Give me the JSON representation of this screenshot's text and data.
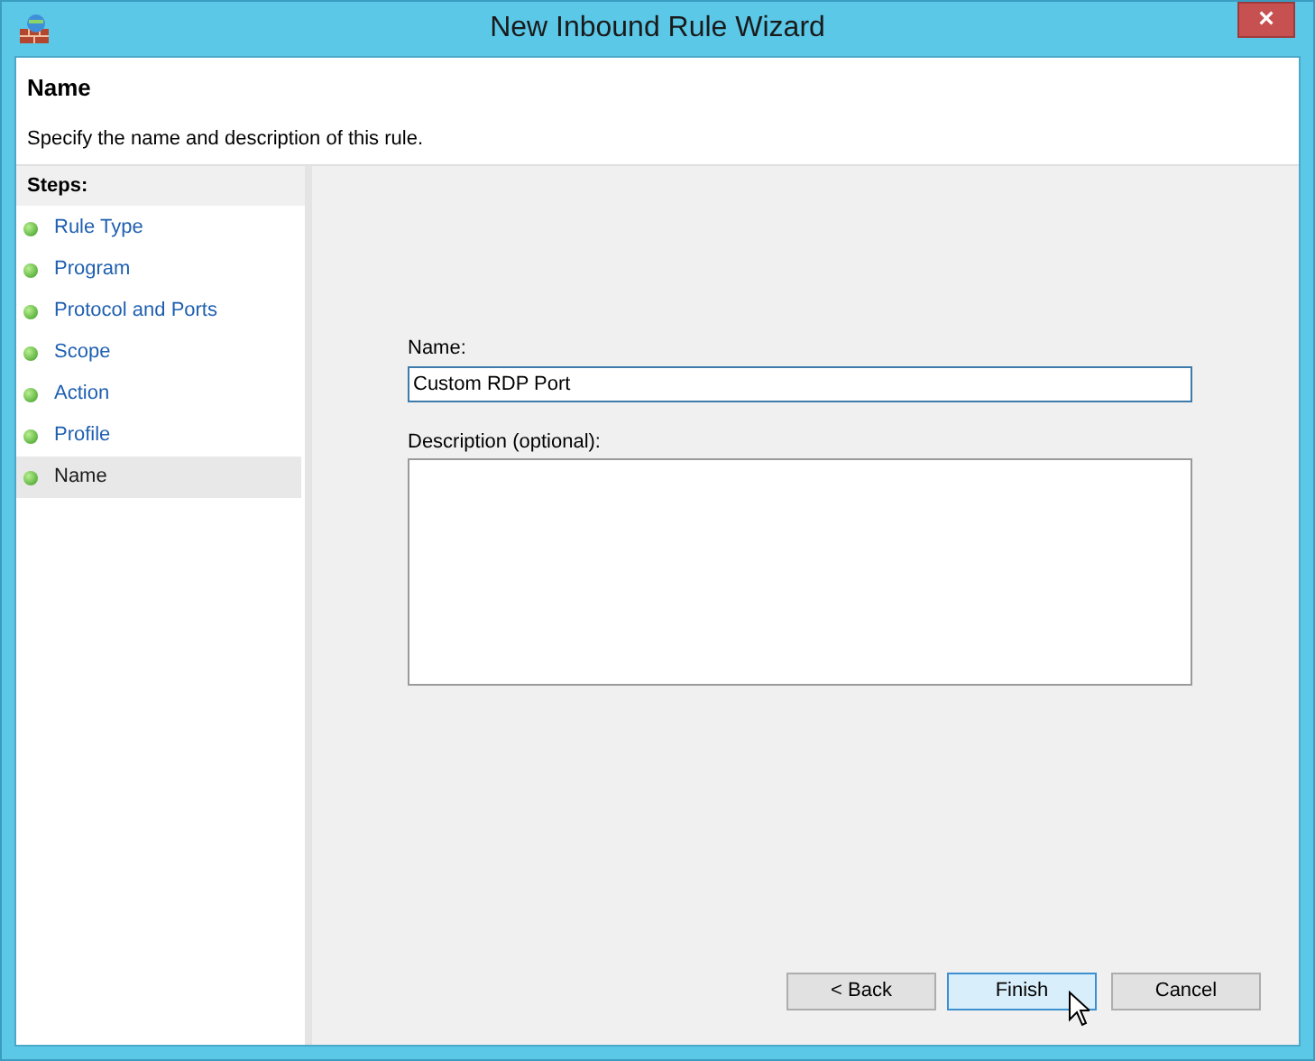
{
  "window": {
    "title": "New Inbound Rule Wizard",
    "close": "×"
  },
  "header": {
    "title": "Name",
    "subtitle": "Specify the name and description of this rule."
  },
  "steps": {
    "heading": "Steps:",
    "items": [
      {
        "label": "Rule Type",
        "selected": false
      },
      {
        "label": "Program",
        "selected": false
      },
      {
        "label": "Protocol and Ports",
        "selected": false
      },
      {
        "label": "Scope",
        "selected": false
      },
      {
        "label": "Action",
        "selected": false
      },
      {
        "label": "Profile",
        "selected": false
      },
      {
        "label": "Name",
        "selected": true
      }
    ]
  },
  "form": {
    "name_label": "Name:",
    "name_value": "Custom RDP Port",
    "description_label": "Description (optional):"
  },
  "buttons": [
    {
      "label": "< Back",
      "hovered": false
    },
    {
      "label": "Finish",
      "hovered": true
    },
    {
      "label": "Cancel",
      "hovered": false
    }
  ]
}
